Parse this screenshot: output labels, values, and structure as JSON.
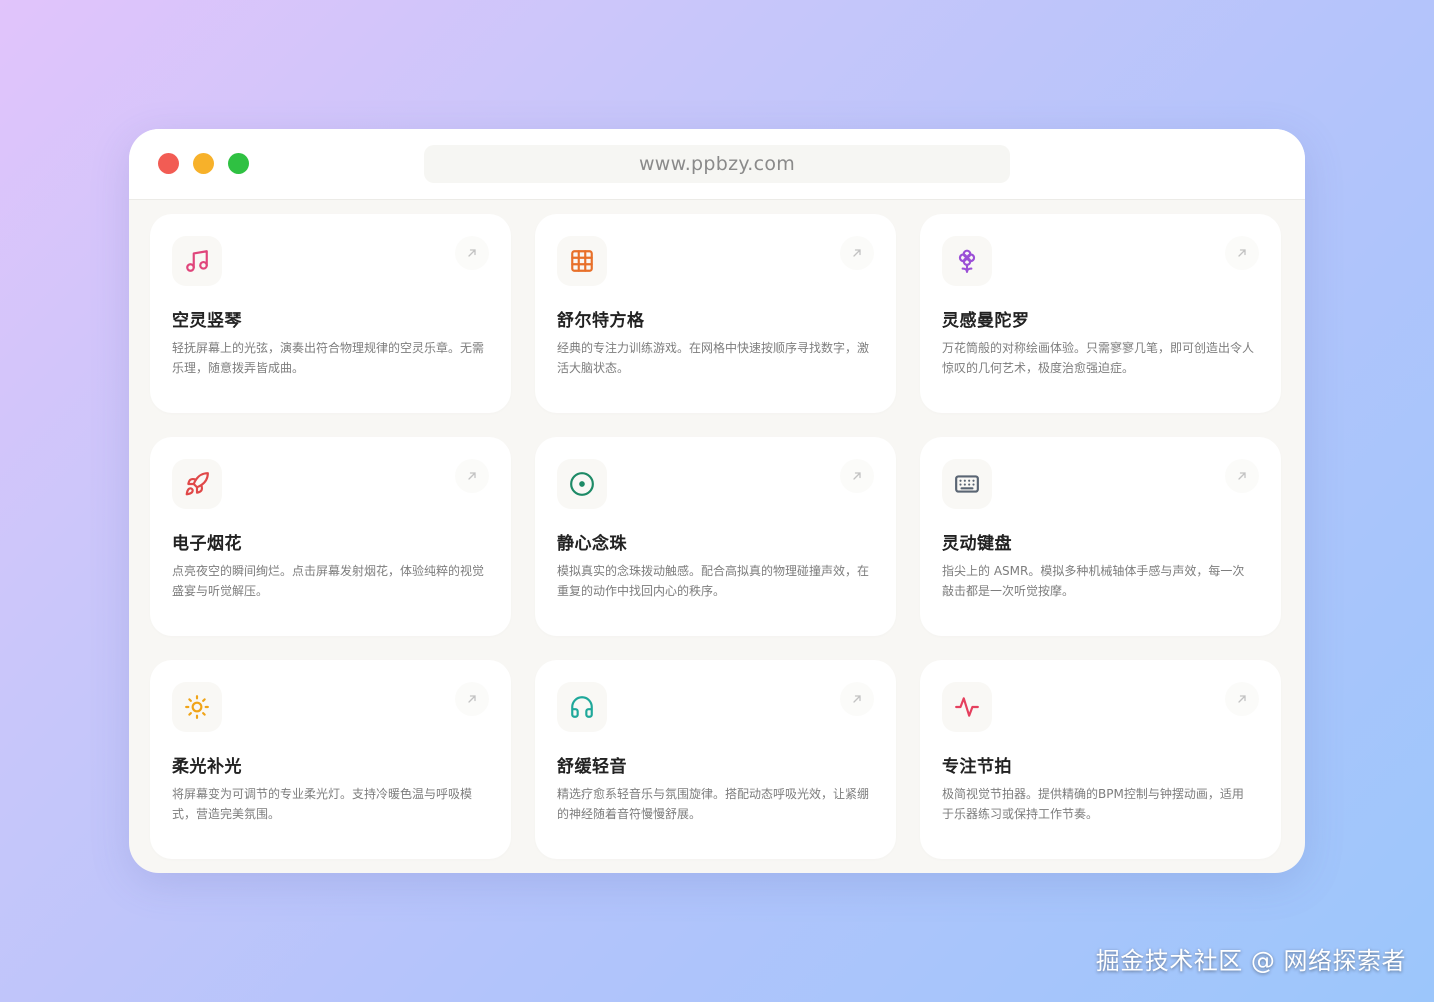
{
  "browser": {
    "url": "www.ppbzy.com"
  },
  "cards": [
    {
      "title": "空灵竖琴",
      "desc": "轻抚屏幕上的光弦，演奏出符合物理规律的空灵乐章。无需乐理，随意拨弄皆成曲。",
      "icon": "music-note-icon",
      "color": "#e0457b"
    },
    {
      "title": "舒尔特方格",
      "desc": "经典的专注力训练游戏。在网格中快速按顺序寻找数字，激活大脑状态。",
      "icon": "grid-icon",
      "color": "#e8702a"
    },
    {
      "title": "灵感曼陀罗",
      "desc": "万花筒般的对称绘画体验。只需寥寥几笔，即可创造出令人惊叹的几何艺术，极度治愈强迫症。",
      "icon": "flower-icon",
      "color": "#9b4fd6"
    },
    {
      "title": "电子烟花",
      "desc": "点亮夜空的瞬间绚烂。点击屏幕发射烟花，体验纯粹的视觉盛宴与听觉解压。",
      "icon": "rocket-icon",
      "color": "#e04848"
    },
    {
      "title": "静心念珠",
      "desc": "模拟真实的念珠拨动触感。配合高拟真的物理碰撞声效，在重复的动作中找回内心的秩序。",
      "icon": "target-icon",
      "color": "#1d8a66"
    },
    {
      "title": "灵动键盘",
      "desc": "指尖上的 ASMR。模拟多种机械轴体手感与声效，每一次敲击都是一次听觉按摩。",
      "icon": "keyboard-icon",
      "color": "#5a6573"
    },
    {
      "title": "柔光补光",
      "desc": "将屏幕变为可调节的专业柔光灯。支持冷暖色温与呼吸模式，营造完美氛围。",
      "icon": "sun-icon",
      "color": "#f0a418"
    },
    {
      "title": "舒缓轻音",
      "desc": "精选疗愈系轻音乐与氛围旋律。搭配动态呼吸光效，让紧绷的神经随着音符慢慢舒展。",
      "icon": "headphones-icon",
      "color": "#1fa89a"
    },
    {
      "title": "专注节拍",
      "desc": "极简视觉节拍器。提供精确的BPM控制与钟摆动画，适用于乐器练习或保持工作节奏。",
      "icon": "pulse-icon",
      "color": "#e5405e"
    }
  ],
  "watermark": "掘金技术社区 @ 网络探索者"
}
